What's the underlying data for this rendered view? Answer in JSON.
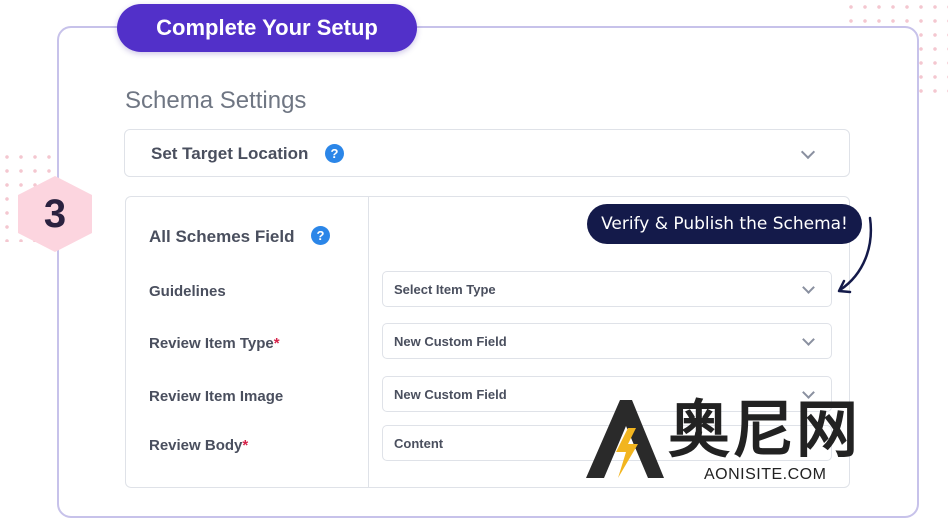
{
  "setup": {
    "title": "Complete Your Setup"
  },
  "section": {
    "title": "Schema Settings"
  },
  "target": {
    "label": "Set Target Location",
    "help": "?"
  },
  "step": {
    "number": "3"
  },
  "schemes": {
    "title": "All Schemes Field",
    "help": "?",
    "fields": [
      {
        "label": "Guidelines",
        "required": false,
        "value": "Select Item Type"
      },
      {
        "label": "Review Item Type",
        "required": true,
        "value": "New Custom Field"
      },
      {
        "label": "Review Item Image",
        "required": false,
        "value": "New Custom Field"
      },
      {
        "label": "Review Body",
        "required": true,
        "value": "Content"
      }
    ],
    "required_mark": "*"
  },
  "callout": {
    "text": "Verify & Publish the Schema!"
  },
  "watermark": {
    "chinese": "奥尼网",
    "site": "AONISITE.COM"
  },
  "colors": {
    "accent": "#5230c9",
    "callout_bg": "#141a4a",
    "help_icon": "#2b86e8",
    "required": "#d6234a",
    "step_bg": "#fcd5df"
  }
}
